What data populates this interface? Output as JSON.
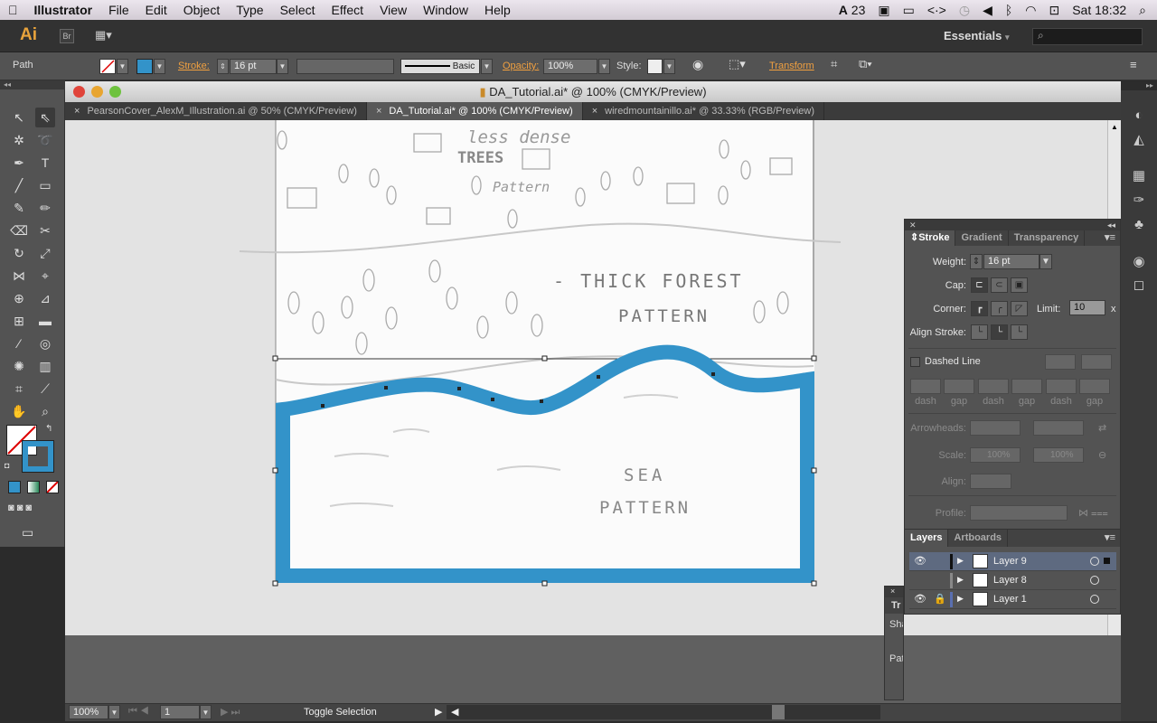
{
  "menubar": {
    "apple": "",
    "app": "Illustrator",
    "items": [
      "File",
      "Edit",
      "Object",
      "Type",
      "Select",
      "Effect",
      "View",
      "Window",
      "Help"
    ],
    "status": {
      "adobe_count": "23",
      "clock": "Sat 18:32"
    }
  },
  "appbar": {
    "logo": "Ai",
    "bridge": "Br",
    "workspace": "Essentials",
    "search_placeholder": ""
  },
  "control": {
    "selection": "Path",
    "stroke_label": "Stroke:",
    "stroke_weight": "16 pt",
    "brush": "Basic",
    "opacity_label": "Opacity:",
    "opacity": "100%",
    "style_label": "Style:",
    "transform_label": "Transform"
  },
  "document": {
    "title": "DA_Tutorial.ai* @ 100% (CMYK/Preview)",
    "tabs": [
      {
        "label": "PearsonCover_AlexM_Illustration.ai @ 50% (CMYK/Preview)"
      },
      {
        "label": "DA_Tutorial.ai* @ 100% (CMYK/Preview)",
        "active": true
      },
      {
        "label": "wiredmountainillo.ai* @ 33.33% (RGB/Preview)"
      }
    ],
    "sketch_text": {
      "less_dense": "less dense",
      "trees": "TREES",
      "pattern1": "Pattern",
      "thick_forest": "- THICK FOREST",
      "pattern2": "PATTERN",
      "sea": "SEA",
      "pattern3": "PATTERN"
    },
    "stroke_color": "#3393c9"
  },
  "statusbar": {
    "zoom": "100%",
    "page": "1",
    "status": "Toggle Selection"
  },
  "stroke_panel": {
    "tabs": [
      "Stroke",
      "Gradient",
      "Transparency"
    ],
    "weight_label": "Weight:",
    "weight": "16 pt",
    "cap_label": "Cap:",
    "corner_label": "Corner:",
    "limit_label": "Limit:",
    "limit": "10",
    "limit_unit": "x",
    "align_label": "Align Stroke:",
    "dashed_label": "Dashed Line",
    "dashed_checked": false,
    "dash_labels": [
      "dash",
      "gap",
      "dash",
      "gap",
      "dash",
      "gap"
    ],
    "arrowheads_label": "Arrowheads:",
    "scale_label": "Scale:",
    "scale1": "100%",
    "scale2": "100%",
    "align2_label": "Align:",
    "profile_label": "Profile:"
  },
  "layers_panel": {
    "tabs": [
      "Layers",
      "Artboards"
    ],
    "layers": [
      {
        "name": "Layer 9",
        "visible": true,
        "locked": false,
        "color": "#111111",
        "selected": true
      },
      {
        "name": "Layer 8",
        "visible": false,
        "locked": false,
        "color": "#888888",
        "selected": false
      },
      {
        "name": "Layer 1",
        "visible": true,
        "locked": true,
        "color": "#5a6fb0",
        "selected": false
      }
    ]
  },
  "mini_panel": {
    "tab": "Tr",
    "row1": "Sha",
    "row2": "Pat"
  }
}
